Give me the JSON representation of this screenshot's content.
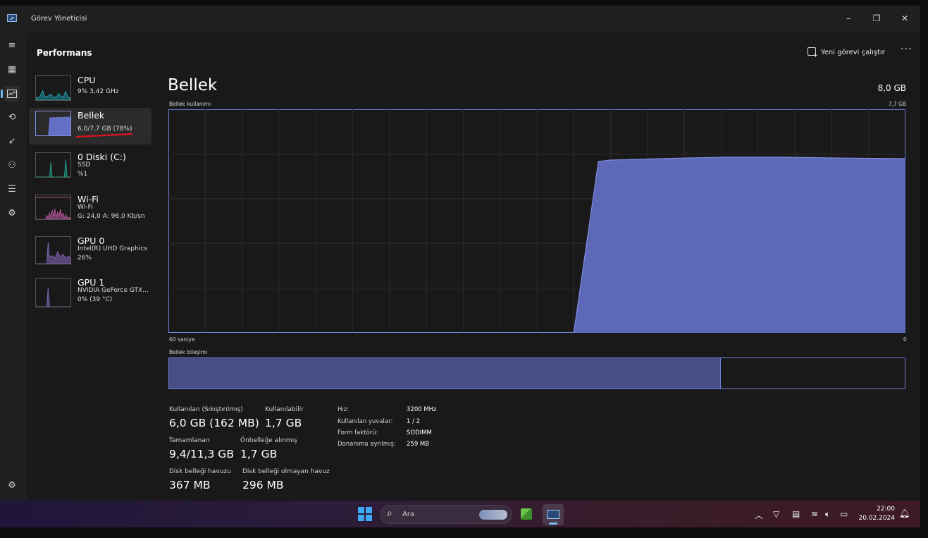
{
  "window": {
    "title": "Görev Yöneticisi",
    "controls": {
      "minimize": "–",
      "maximize": "❐",
      "close": "✕"
    }
  },
  "nav": {
    "icons": [
      "hamburger-icon",
      "processes-icon",
      "performance-icon",
      "history-icon",
      "startup-icon",
      "users-icon",
      "details-icon",
      "services-icon",
      "settings-icon"
    ]
  },
  "header": {
    "title": "Performans",
    "run_task_label": "Yeni görevi çalıştır",
    "more_label": "···"
  },
  "sidebar": {
    "items": [
      {
        "name": "CPU",
        "line1": "9% 3,42 GHz",
        "line2": ""
      },
      {
        "name": "Bellek",
        "line1": "6,0/7,7 GB (78%)",
        "line2": ""
      },
      {
        "name": "0 Diski (C:)",
        "line1": "SSD",
        "line2": "%1"
      },
      {
        "name": "Wi-Fi",
        "line1": "Wi-Fi",
        "line2": "G: 24,0 A: 96,0 Kb/sn"
      },
      {
        "name": "GPU 0",
        "line1": "Intel(R) UHD Graphics",
        "line2": "26%"
      },
      {
        "name": "GPU 1",
        "line1": "NVIDIA GeForce GTX...",
        "line2": "0% (39 °C)"
      }
    ]
  },
  "memory": {
    "title": "Bellek",
    "total": "8,0 GB",
    "usage_label": "Bellek kullanımı",
    "usage_max": "7,7 GB",
    "time_left": "60 saniye",
    "time_right": "0",
    "composition_label": "Bellek bileşimi",
    "composition_used_fraction": 0.75,
    "stats": {
      "in_use_label": "Kullanılan (Sıkıştırılmış)",
      "in_use_value": "6,0 GB (162 MB)",
      "available_label": "Kullanılabilir",
      "available_value": "1,7 GB",
      "committed_label": "Tamamlanan",
      "committed_value": "9,4/11,3 GB",
      "cached_label": "Önbelleğe alınmış",
      "cached_value": "1,7 GB",
      "paged_label": "Disk belleği havuzu",
      "paged_value": "367 MB",
      "nonpaged_label": "Disk belleği olmayan havuz",
      "nonpaged_value": "296 MB"
    },
    "details": [
      {
        "key": "Hız:",
        "value": "3200 MHz"
      },
      {
        "key": "Kullanılan yuvalar:",
        "value": "1 / 2"
      },
      {
        "key": "Form faktörü:",
        "value": "SODIMM"
      },
      {
        "key": "Donanıma ayrılmış:",
        "value": "259 MB"
      }
    ]
  },
  "chart_data": {
    "type": "area",
    "x_label_left": "60 saniye",
    "x_label_right": "0",
    "ylim": [
      0,
      7.7
    ],
    "x": [
      60,
      27,
      25,
      24,
      20,
      15,
      10,
      5,
      0
    ],
    "values": [
      0,
      0,
      5.9,
      5.95,
      6.0,
      6.05,
      6.05,
      6.02,
      6.0
    ],
    "color": "#6370c4"
  },
  "taskbar": {
    "search_label": "Ara",
    "time": "22:00",
    "date": "20.02.2024"
  },
  "colors": {
    "memory_fill": "#6370c4",
    "memory_line": "#7f8ce0",
    "accent": "#76b9ed",
    "cpu_graph": "#1fa8b8",
    "disk_graph": "#1f9b8a",
    "wifi_graph": "#c25aa6",
    "gpu_graph": "#8c6cc4"
  }
}
